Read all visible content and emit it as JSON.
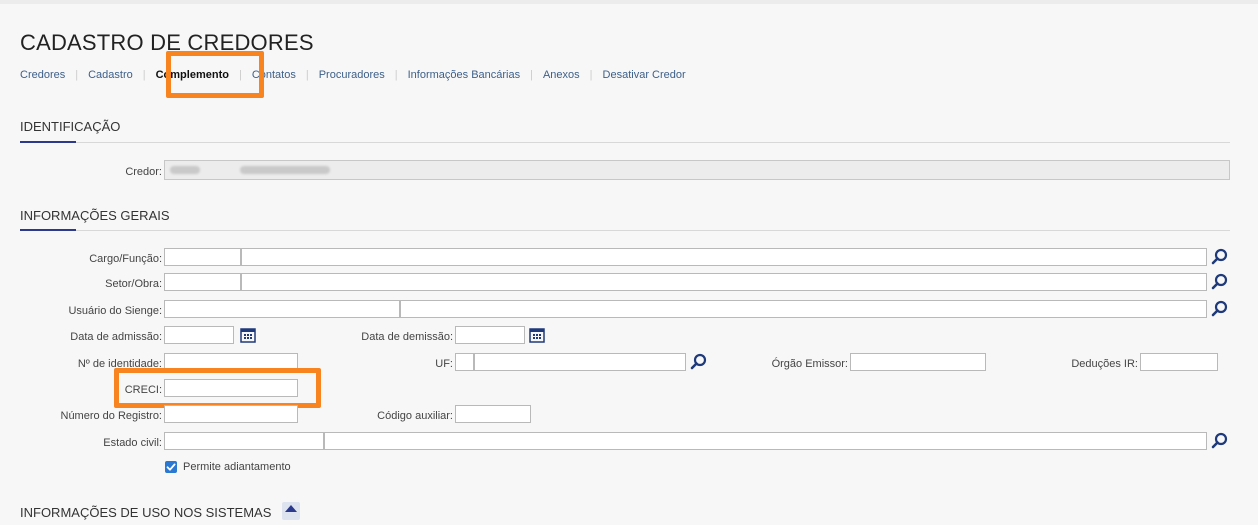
{
  "page": {
    "title": "CADASTRO DE CREDORES"
  },
  "tabs": [
    {
      "label": "Credores"
    },
    {
      "label": "Cadastro"
    },
    {
      "label": "Complemento"
    },
    {
      "label": "Contatos"
    },
    {
      "label": "Procuradores"
    },
    {
      "label": "Informações Bancárias"
    },
    {
      "label": "Anexos"
    },
    {
      "label": "Desativar Credor"
    }
  ],
  "sections": {
    "identificacao": "IDENTIFICAÇÃO",
    "gerais": "INFORMAÇÕES GERAIS",
    "uso": "INFORMAÇÕES DE USO NOS SISTEMAS"
  },
  "identificacao": {
    "credor_label": "Credor:"
  },
  "form": {
    "cargo_label": "Cargo/Função:",
    "setor_label": "Setor/Obra:",
    "usuario_label": "Usuário do Sienge:",
    "admissao_label": "Data de admissão:",
    "demissao_label": "Data de demissão:",
    "identidade_label": "Nº de identidade:",
    "uf_label": "UF:",
    "orgao_label": "Órgão Emissor:",
    "deducoes_label": "Deduções IR:",
    "creci_label": "CRECI:",
    "registro_label": "Número do Registro:",
    "codigo_label": "Código auxiliar:",
    "estado_civil_label": "Estado civil:",
    "adiantamento_label": "Permite adiantamento"
  },
  "colors": {
    "highlight": "#f7841f",
    "link": "#3d5f8a",
    "accent": "#2b3a8c",
    "checkbox": "#2a78d2"
  },
  "icons": {
    "search": "magnifier-icon",
    "calendar": "calendar-icon",
    "check": "check-icon"
  }
}
